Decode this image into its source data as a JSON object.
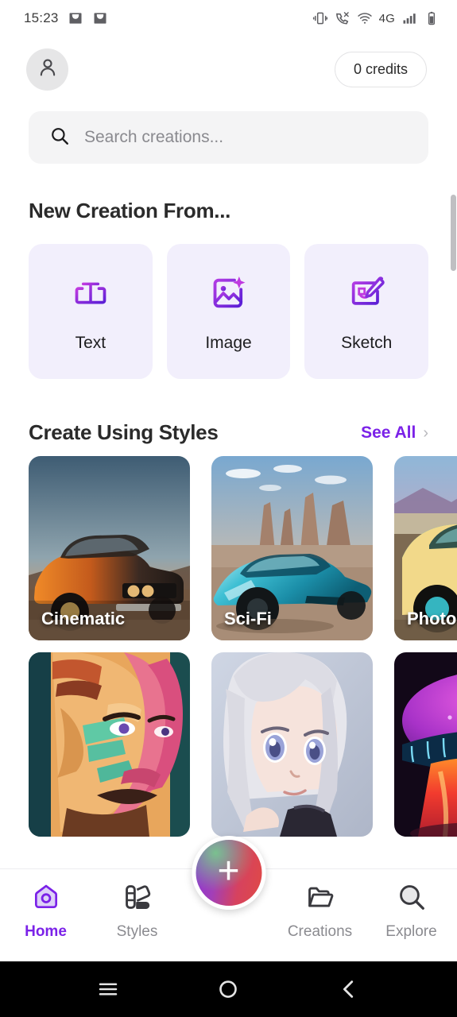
{
  "statusbar": {
    "time": "15:23",
    "left_icons": [
      "mail-icon",
      "mail-icon"
    ],
    "right_icons": [
      "vibrate-icon",
      "call-mute-icon",
      "wifi-icon",
      "signal-bars-icon",
      "battery-icon"
    ],
    "network_label": "4G"
  },
  "header": {
    "avatar_icon": "person-icon",
    "credits_label": "0 credits"
  },
  "search": {
    "icon": "search-icon",
    "placeholder": "Search creations...",
    "value": ""
  },
  "new_creation": {
    "title": "New Creation From...",
    "options": [
      {
        "label": "Text",
        "icon": "text-box-icon"
      },
      {
        "label": "Image",
        "icon": "image-sparkle-icon"
      },
      {
        "label": "Sketch",
        "icon": "sketch-pencil-icon"
      }
    ]
  },
  "styles_section": {
    "title": "Create Using Styles",
    "see_all_label": "See All",
    "chevron_icon": "chevron-right-icon",
    "rows": [
      [
        {
          "label": "Cinematic",
          "subject": "vintage-muscle-car-dusk"
        },
        {
          "label": "Sci-Fi",
          "subject": "futuristic-teal-car-desert"
        },
        {
          "label": "Photog",
          "subject": "classic-teal-yellow-car"
        }
      ],
      [
        {
          "label": "",
          "subject": "colorful-geometric-portrait"
        },
        {
          "label": "",
          "subject": "anime-girl-white-hair"
        },
        {
          "label": "",
          "subject": "glowing-purple-mushroom"
        }
      ]
    ]
  },
  "bottom_nav": {
    "items": [
      {
        "label": "Home",
        "icon": "home-icon",
        "active": true
      },
      {
        "label": "Styles",
        "icon": "palette-icon",
        "active": false
      },
      {
        "label": "Creations",
        "icon": "folder-icon",
        "active": false
      },
      {
        "label": "Explore",
        "icon": "magnifier-icon",
        "active": false
      }
    ],
    "fab": {
      "icon": "plus-icon",
      "label": "+"
    }
  },
  "android_nav": {
    "buttons": [
      "recents-icon",
      "home-circle-icon",
      "back-chevron-icon"
    ]
  },
  "colors": {
    "accent_purple": "#7B22E8",
    "card_bg": "#f2effc",
    "search_bg": "#f4f4f5",
    "text_primary": "#2b2b2b",
    "text_muted": "#8b8b90"
  }
}
